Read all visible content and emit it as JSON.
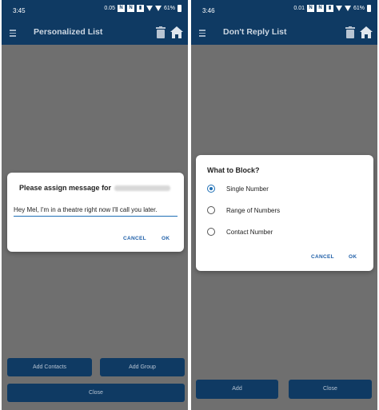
{
  "left": {
    "status": {
      "time": "3:45",
      "speed": "0.05",
      "battery": "61%"
    },
    "toolbar": {
      "title": "Personalized List"
    },
    "dialog": {
      "title": "Please assign message for",
      "message_value": "Hey Mel, I'm in a theatre right now I'll call you later.",
      "cancel": "CANCEL",
      "ok": "OK"
    },
    "buttons": {
      "add_contacts": "Add Contacts",
      "add_group": "Add Group",
      "close": "Close"
    }
  },
  "right": {
    "status": {
      "time": "3:46",
      "speed": "0.01",
      "battery": "61%"
    },
    "toolbar": {
      "title": "Don't Reply List"
    },
    "dialog": {
      "title": "What to Block?",
      "options": [
        "Single Number",
        "Range of Numbers",
        "Contact Number"
      ],
      "selected_index": 0,
      "cancel": "CANCEL",
      "ok": "OK"
    },
    "buttons": {
      "add": "Add",
      "close": "Close"
    }
  },
  "colors": {
    "primary": "#0f3a63",
    "accent": "#1f6fb5",
    "scrim": "#6f6f6f"
  }
}
